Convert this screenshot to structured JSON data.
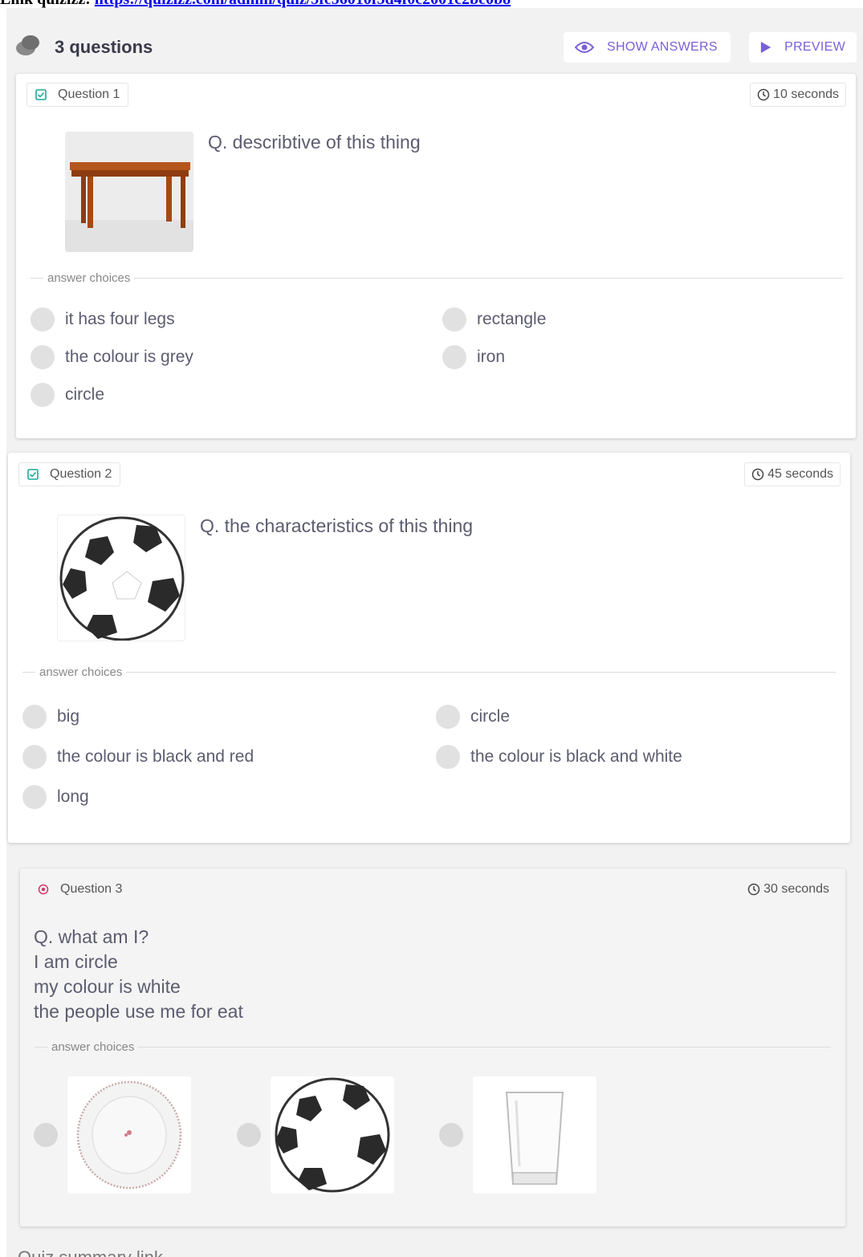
{
  "top_link": {
    "label": "Link quizizz:",
    "url_text": "https://quizizz.com/admin/quiz/5fe56010f5d4f0c2001c2be0b8"
  },
  "header": {
    "title": "3 questions",
    "show_answers_label": "SHOW ANSWERS",
    "preview_label": "PREVIEW",
    "accent_color": "#7a5fd6"
  },
  "divider_label": "answer choices",
  "questions": [
    {
      "tag": "Question 1",
      "time": "10 seconds",
      "text": "Q. describtive of this thing",
      "image": "table-image",
      "options": [
        "it has four legs",
        "rectangle",
        "the colour is grey",
        "iron",
        "circle"
      ]
    },
    {
      "tag": "Question 2",
      "time": "45 seconds",
      "text": "Q. the characteristics of this thing",
      "image": "soccer-ball-image",
      "options": [
        "big",
        "circle",
        "the colour is black and red",
        "the colour is black and white",
        "long"
      ]
    },
    {
      "tag": "Question 3",
      "time": "30 seconds",
      "text_lines": [
        "Q. what am I?",
        "I am circle",
        "my colour is white",
        "the people use me for eat"
      ],
      "image_options": [
        "plate-image",
        "soccer-ball-image",
        "glass-image"
      ]
    }
  ],
  "footer_peek": "Quiz summary link"
}
